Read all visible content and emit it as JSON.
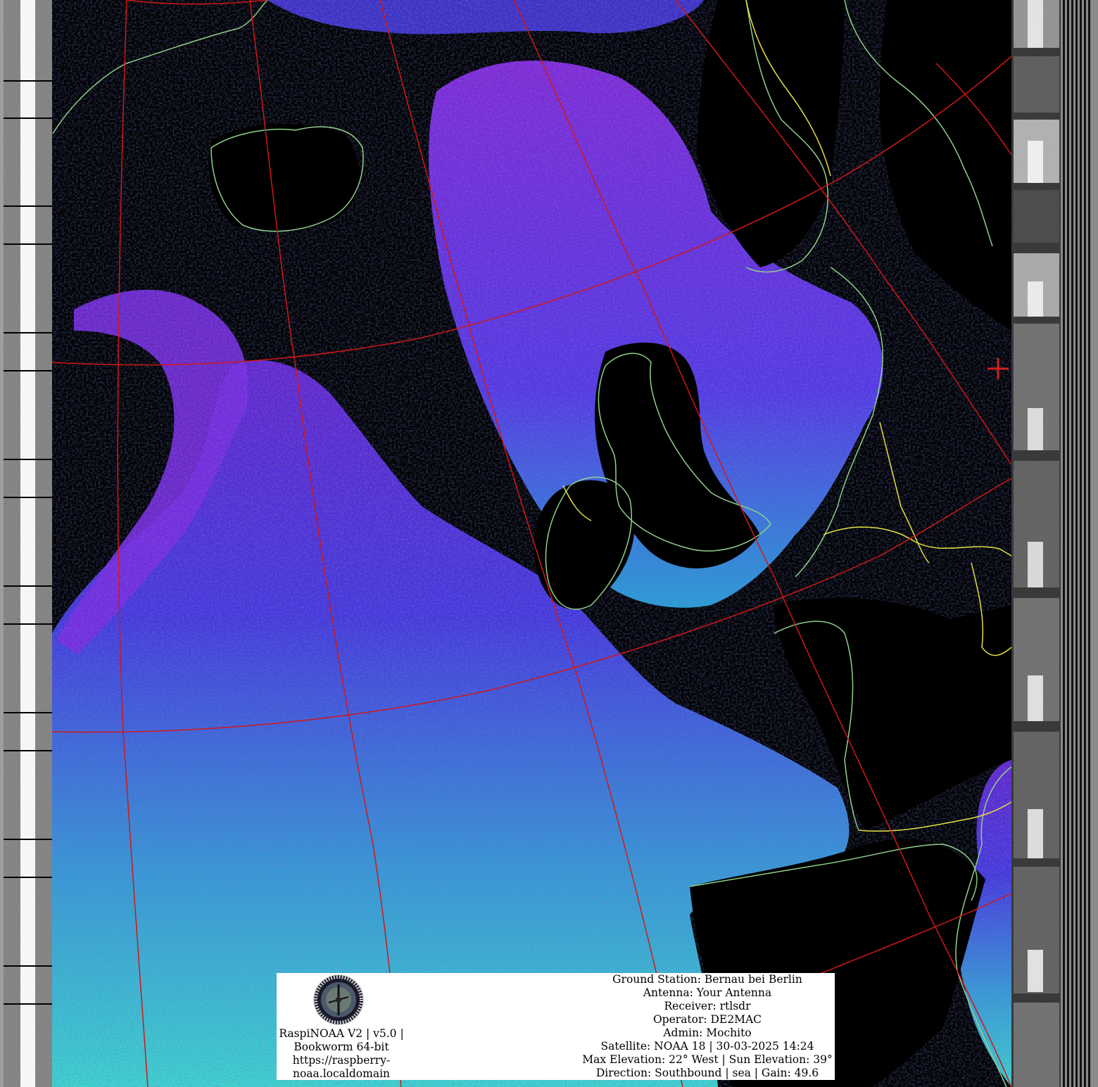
{
  "colors": {
    "background": "#000000",
    "coastline": "#8fd18a",
    "border": "#e6e040",
    "graticule": "#d01818",
    "cloud_violet": "#8a2be2",
    "cloud_blue": "#3a3af0",
    "cloud_cyan": "#38d8e8",
    "panel": "#ffffff"
  },
  "icons": [
    "logo-seal-icon",
    "crosshair-icon"
  ],
  "caption": {
    "line1": "RaspiNOAA V2 | v5.0 |",
    "line2": "Bookworm 64-bit",
    "line3": "https://raspberry-",
    "line4": "noaa.localdomain"
  },
  "station": {
    "ground_station": "Ground Station: Bernau bei Berlin",
    "antenna": "Antenna: Your Antenna",
    "receiver": "Receiver: rtlsdr",
    "operator": "Operator: DE2MAC",
    "admin": "Admin: Mochito",
    "satellite": "Satellite: NOAA 18 | 30-03-2025 14:24",
    "elevation": "Max Elevation: 22° West | Sun Elevation: 39°",
    "direction": "Direction: Southbound | sea | Gain: 49.6"
  }
}
